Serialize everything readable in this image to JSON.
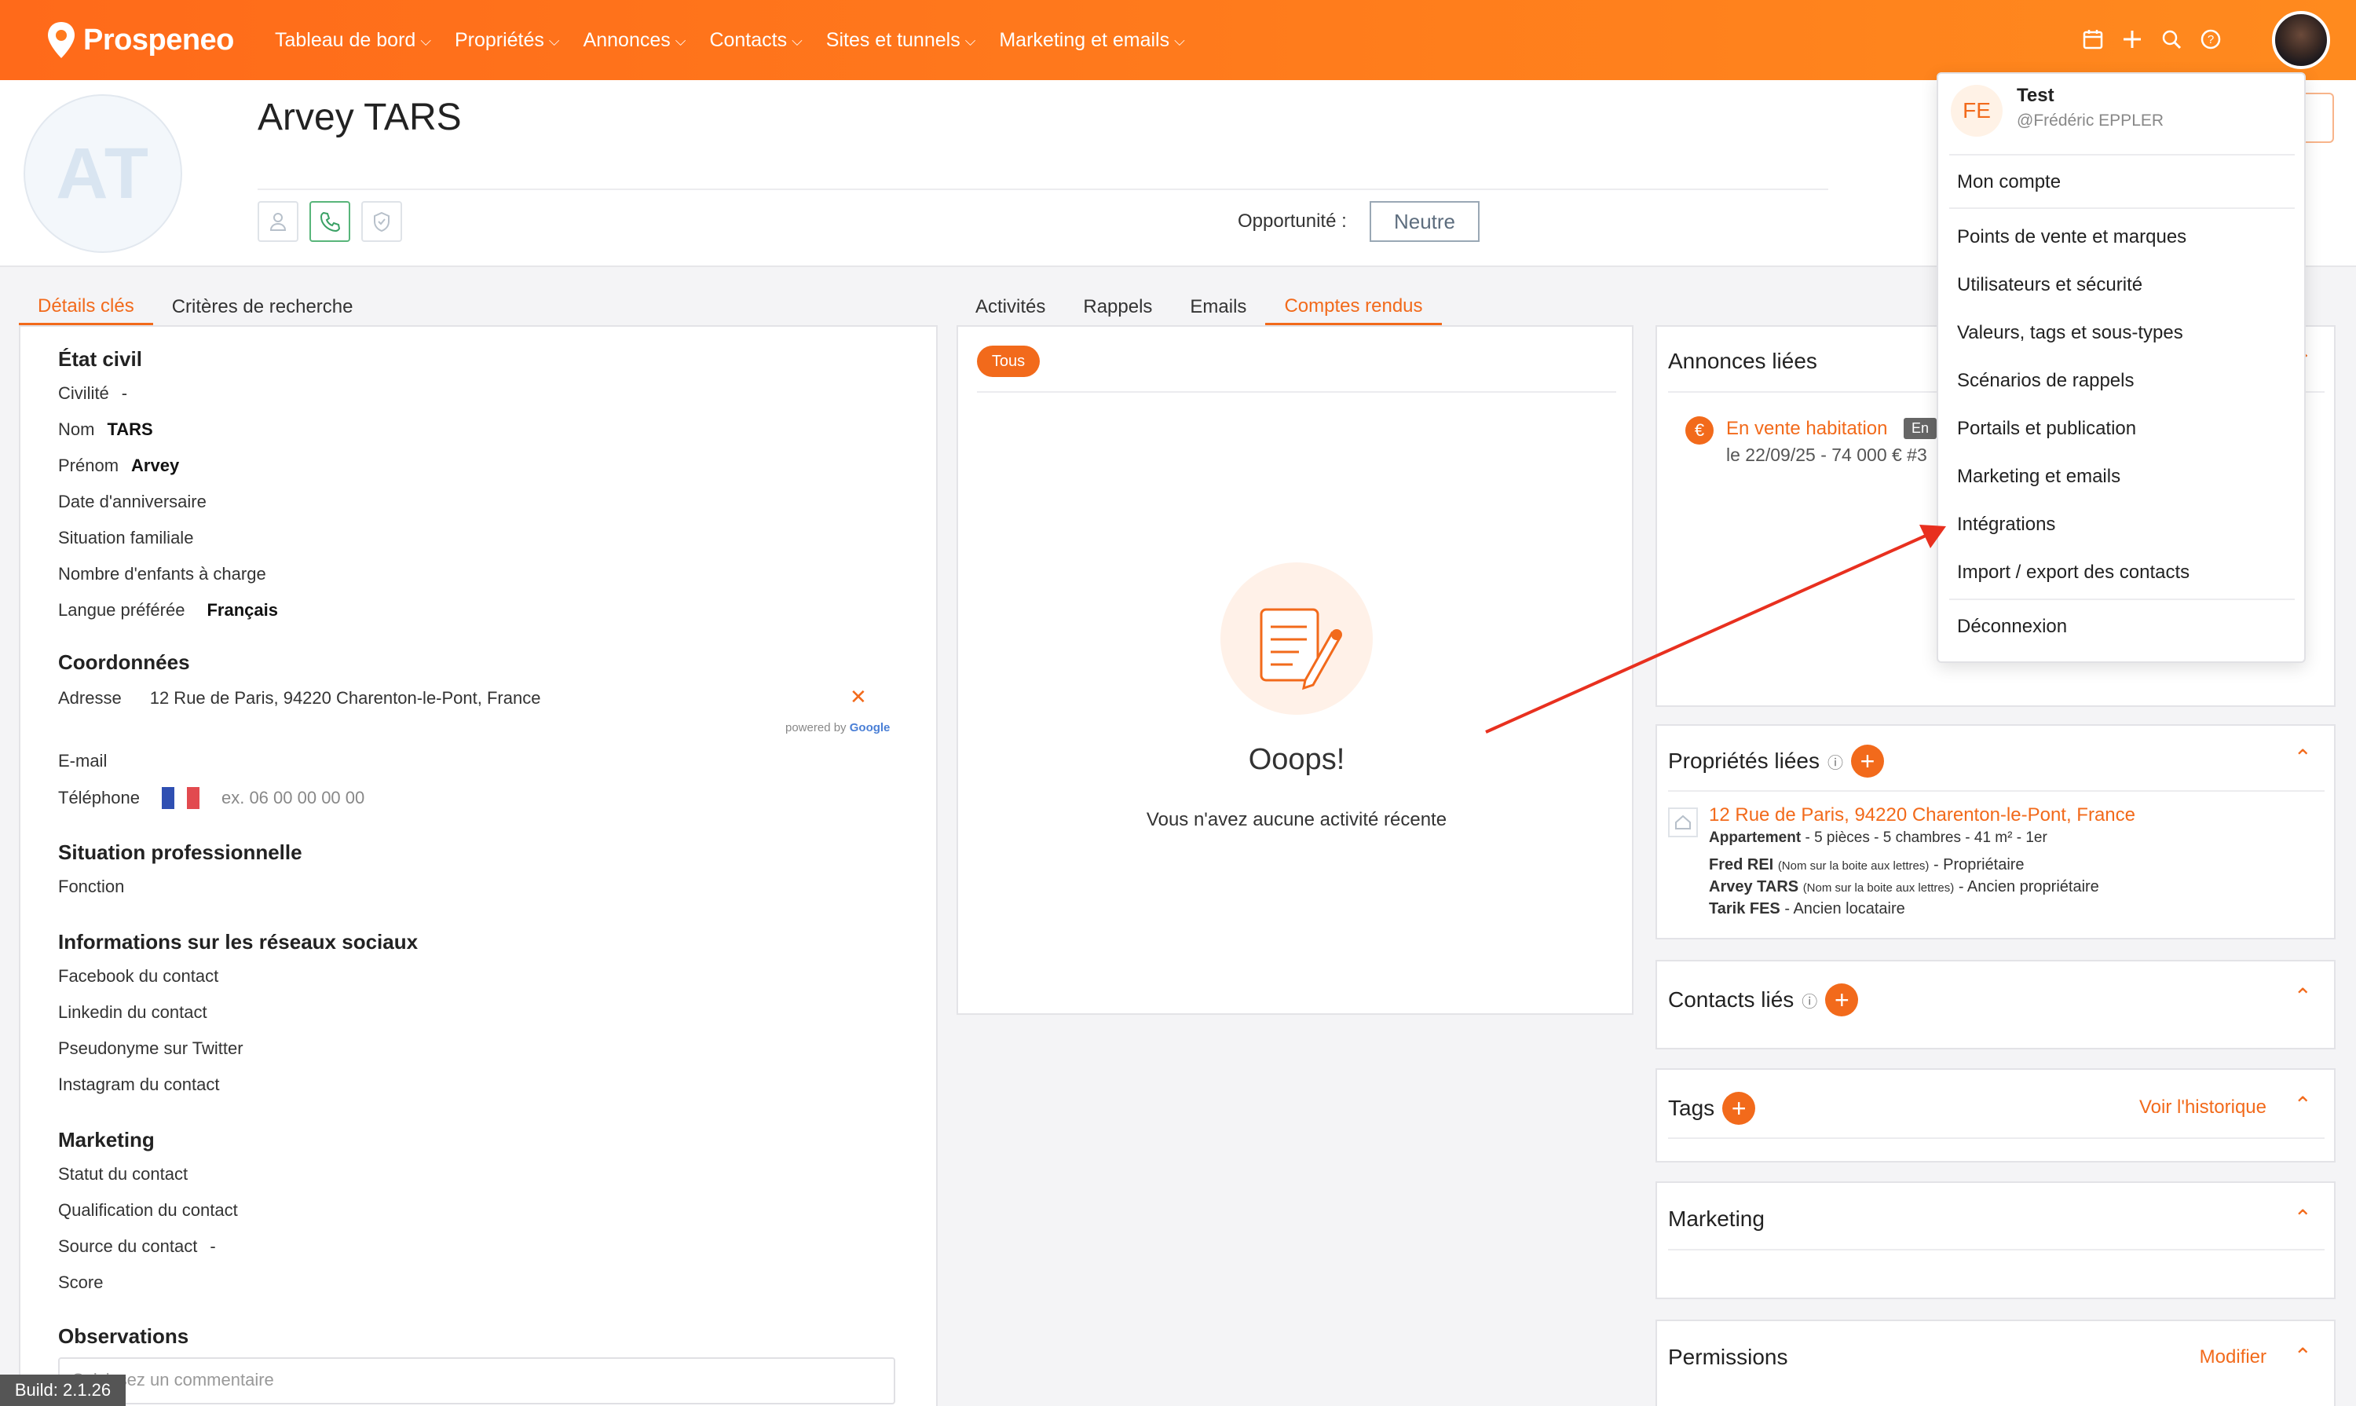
{
  "brand": {
    "name": "Prospeneo"
  },
  "nav": {
    "items": [
      {
        "label": "Tableau de bord"
      },
      {
        "label": "Propriétés"
      },
      {
        "label": "Annonces"
      },
      {
        "label": "Contacts"
      },
      {
        "label": "Sites et tunnels"
      },
      {
        "label": "Marketing et emails"
      }
    ]
  },
  "contact": {
    "initials": "AT",
    "name": "Arvey TARS",
    "opportunity_label": "Opportunité :",
    "opportunity_value": "Neutre"
  },
  "tabs_left": [
    "Détails clés",
    "Critères de recherche"
  ],
  "tabs_mid": [
    "Activités",
    "Rappels",
    "Emails",
    "Comptes rendus"
  ],
  "details": {
    "etat_civil": "État civil",
    "civilite_label": "Civilité",
    "civilite_value": "-",
    "nom_label": "Nom",
    "nom_value": "TARS",
    "prenom_label": "Prénom",
    "prenom_value": "Arvey",
    "anniversaire_label": "Date d'anniversaire",
    "situation_label": "Situation familiale",
    "enfants_label": "Nombre d'enfants à charge",
    "langue_label": "Langue préférée",
    "langue_value": "Français",
    "coordonnees": "Coordonnées",
    "adresse_label": "Adresse",
    "adresse_value": "12 Rue de Paris, 94220 Charenton-le-Pont, France",
    "powered_prefix": "powered by",
    "powered_google": "Google",
    "email_label": "E-mail",
    "tel_label": "Téléphone",
    "tel_placeholder": "ex. 06 00 00 00 00",
    "pro": "Situation professionnelle",
    "fonction_label": "Fonction",
    "social": "Informations sur les réseaux sociaux",
    "facebook_label": "Facebook du contact",
    "linkedin_label": "Linkedin du contact",
    "twitter_label": "Pseudonyme sur Twitter",
    "instagram_label": "Instagram du contact",
    "marketing": "Marketing",
    "statut_label": "Statut du contact",
    "qualif_label": "Qualification du contact",
    "source_label": "Source du contact",
    "source_value": "-",
    "score_label": "Score",
    "observations": "Observations",
    "comment_placeholder": "Saisissez un commentaire"
  },
  "activity": {
    "filter": "Tous",
    "empty_title": "Ooops!",
    "empty_text": "Vous n'avez aucune activité récente"
  },
  "annonces": {
    "title": "Annonces liées",
    "item_title": "En vente habitation",
    "item_badge": "En",
    "item_meta": "le 22/09/25 - 74 000 € #3"
  },
  "proprietes": {
    "title": "Propriétés liées",
    "address": "12 Rue de Paris, 94220 Charenton-le-Pont, France",
    "type": "Appartement",
    "details": " - 5 pièces - 5 chambres - 41 m² - 1er",
    "people": [
      {
        "name": "Fred REI",
        "note": "(Nom sur la boite aux lettres)",
        "role": " - Propriétaire"
      },
      {
        "name": "Arvey TARS",
        "note": "(Nom sur la boite aux lettres)",
        "role": " - Ancien propriétaire"
      },
      {
        "name": "Tarik FES",
        "note": "",
        "role": " - Ancien locataire"
      }
    ]
  },
  "contacts_lies": {
    "title": "Contacts liés"
  },
  "tags": {
    "title": "Tags",
    "history": "Voir l'historique"
  },
  "marketing_panel": {
    "title": "Marketing"
  },
  "permissions": {
    "title": "Permissions",
    "edit": "Modifier"
  },
  "user_menu": {
    "initials": "FE",
    "name": "Test",
    "handle": "@Frédéric EPPLER",
    "items": [
      "Mon compte",
      "Points de vente et marques",
      "Utilisateurs et sécurité",
      "Valeurs, tags et sous-types",
      "Scénarios de rappels",
      "Portails et publication",
      "Marketing et emails",
      "Intégrations",
      "Import / export des contacts",
      "Déconnexion"
    ]
  },
  "build": "Build: 2.1.26",
  "colors": {
    "accent": "#f26a1b",
    "annotation_arrow": "#e8301f"
  }
}
